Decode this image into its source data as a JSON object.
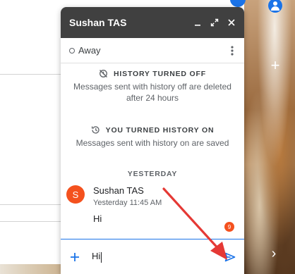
{
  "chat": {
    "title": "Sushan TAS",
    "status": "Away",
    "history_off": {
      "heading": "HISTORY TURNED OFF",
      "body": "Messages sent with history off are deleted after 24 hours"
    },
    "history_on": {
      "heading": "YOU TURNED HISTORY ON",
      "body": "Messages sent with history on are saved"
    },
    "day_separator": "YESTERDAY",
    "message": {
      "avatar_letter": "S",
      "sender": "Sushan TAS",
      "time": "Yesterday 11:45 AM",
      "text": "Hi"
    },
    "unread_count": "9",
    "composer": {
      "value": "Hi"
    }
  },
  "icons": {
    "minimize": "minimize-icon",
    "popout": "popout-icon",
    "close": "close-icon",
    "more": "more-vert-icon",
    "history_off": "history-off-icon",
    "history_on": "history-icon",
    "add": "add-icon",
    "send": "send-icon",
    "account": "account-icon"
  },
  "colors": {
    "header_bg": "#404040",
    "accent": "#1a73e8",
    "avatar": "#f4511e",
    "annotation_arrow": "#e53935"
  }
}
